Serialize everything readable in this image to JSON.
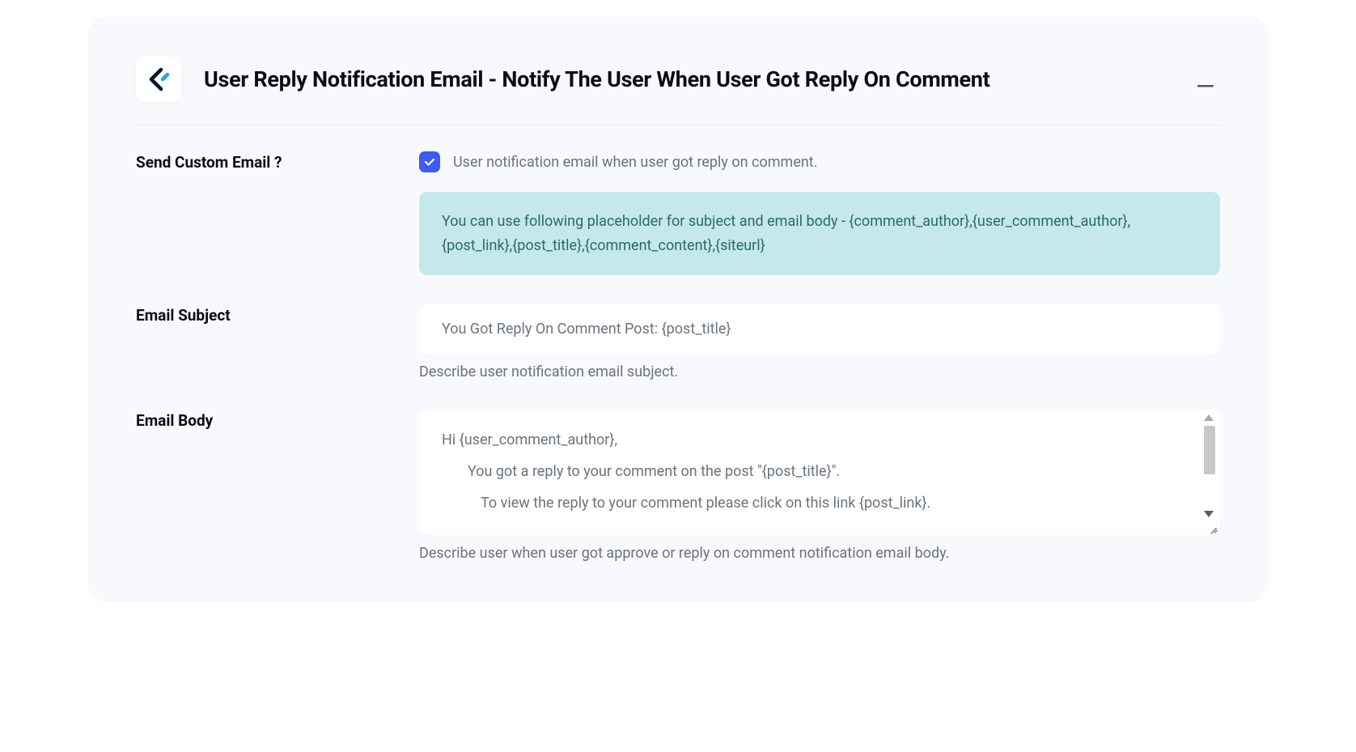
{
  "header": {
    "title": "User Reply Notification Email - Notify The User When User Got Reply On Comment"
  },
  "sections": {
    "custom_email": {
      "label": "Send Custom Email ?",
      "checkbox_label": "User notification email when user got reply on comment.",
      "info_text": "You can use following placeholder for subject and email body - {comment_author},{user_comment_author},{post_link},{post_title},{comment_content},{siteurl}"
    },
    "email_subject": {
      "label": "Email Subject",
      "value": "You Got Reply On Comment Post: {post_title}",
      "help": "Describe user notification email subject."
    },
    "email_body": {
      "label": "Email Body",
      "line1": "Hi {user_comment_author},",
      "line2": "You got a reply to your comment on the post \"{post_title}\".",
      "line3": "To view the reply to your comment please click on this link {post_link}.",
      "help": "Describe user when user got approve or reply on comment notification email body."
    }
  }
}
